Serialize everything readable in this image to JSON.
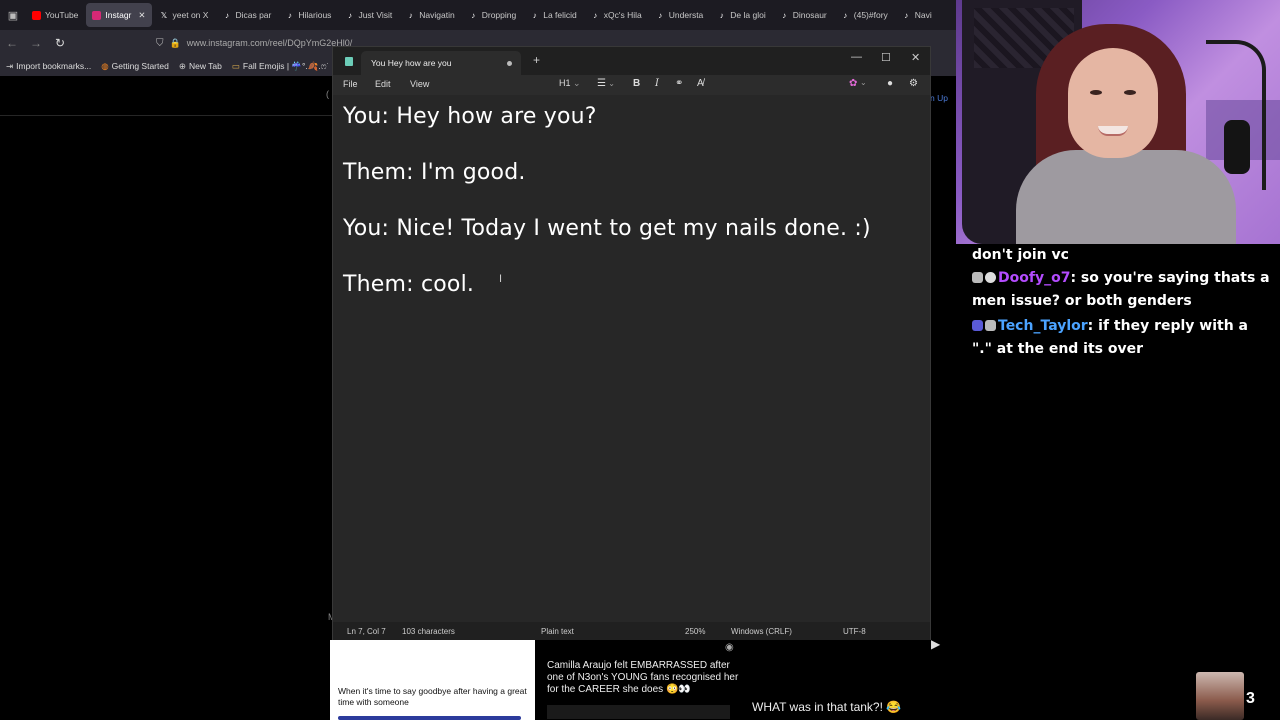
{
  "browser": {
    "tabs": [
      {
        "label": "YouTube",
        "icon": "youtube-icon",
        "color": "#ff0000"
      },
      {
        "label": "Instagr",
        "icon": "instagram-icon",
        "color": "#d62976",
        "active": true
      },
      {
        "label": "yeet on X",
        "icon": "x-icon",
        "color": "#ffffff"
      },
      {
        "label": "Dicas par",
        "icon": "tiktok-icon",
        "color": "#ffffff"
      },
      {
        "label": "Hilarious",
        "icon": "tiktok-icon",
        "color": "#ffffff"
      },
      {
        "label": "Just Visit",
        "icon": "tiktok-icon",
        "color": "#ffffff"
      },
      {
        "label": "Navigatin",
        "icon": "tiktok-icon",
        "color": "#ffffff"
      },
      {
        "label": "Dropping",
        "icon": "tiktok-icon",
        "color": "#ffffff"
      },
      {
        "label": "La felicid",
        "icon": "tiktok-icon",
        "color": "#ffffff"
      },
      {
        "label": "xQc's Hila",
        "icon": "tiktok-icon",
        "color": "#ffffff"
      },
      {
        "label": "Understa",
        "icon": "tiktok-icon",
        "color": "#ffffff"
      },
      {
        "label": "De la gloi",
        "icon": "tiktok-icon",
        "color": "#ffffff"
      },
      {
        "label": "Dinosaur",
        "icon": "tiktok-icon",
        "color": "#ffffff"
      },
      {
        "label": "(45)#fory",
        "icon": "tiktok-icon",
        "color": "#ffffff"
      },
      {
        "label": "Navi",
        "icon": "tiktok-icon",
        "color": "#ffffff"
      }
    ],
    "tab_close": "✕",
    "url": "www.instagram.com/reel/DQpYmG2eHl0/",
    "bookmarks": [
      {
        "label": "Import bookmarks...",
        "icon": "import-icon"
      },
      {
        "label": "Getting Started",
        "icon": "firefox-icon"
      },
      {
        "label": "New Tab",
        "icon": "globe-icon"
      },
      {
        "label": "Fall Emojis | ☔°.🍂.ෆ˙",
        "icon": "folder-icon"
      }
    ],
    "instagram": {
      "signup": "n Up",
      "reels": [
        {
          "caption": "When it's time to say goodbye after having a great time with someone"
        },
        {
          "caption": "Camilla Araujo felt EMBARRASSED after one of N3on's YOUNG fans recognised her for the CAREER she does 😳👀"
        },
        {
          "caption": "WHAT was in that tank?! 😂"
        }
      ]
    }
  },
  "notepad": {
    "tab_title": "You Hey how are you",
    "new_tab": "+",
    "menu": {
      "file": "File",
      "edit": "Edit",
      "view": "View"
    },
    "toolbar": {
      "heading": "H1",
      "bold": "B",
      "italic": "I"
    },
    "lines": [
      "You: Hey how are you?",
      "Them: I'm good.",
      "You: Nice! Today I went to get my nails done. :)",
      "Them: cool."
    ],
    "status": {
      "position": "Ln 7, Col 7",
      "characters": "103 characters",
      "format": "Plain text",
      "zoom": "250%",
      "line_ending": "Windows (CRLF)",
      "encoding": "UTF-8"
    }
  },
  "chat": {
    "messages": [
      {
        "text": "don't join vc"
      },
      {
        "user": "Doofy_o7",
        "text": ": so you're saying thats a men issue? or both genders"
      },
      {
        "user": "Tech_Taylor",
        "text": ": if they reply with a \".\" at the end its over"
      }
    ],
    "viewer_count": "3"
  }
}
